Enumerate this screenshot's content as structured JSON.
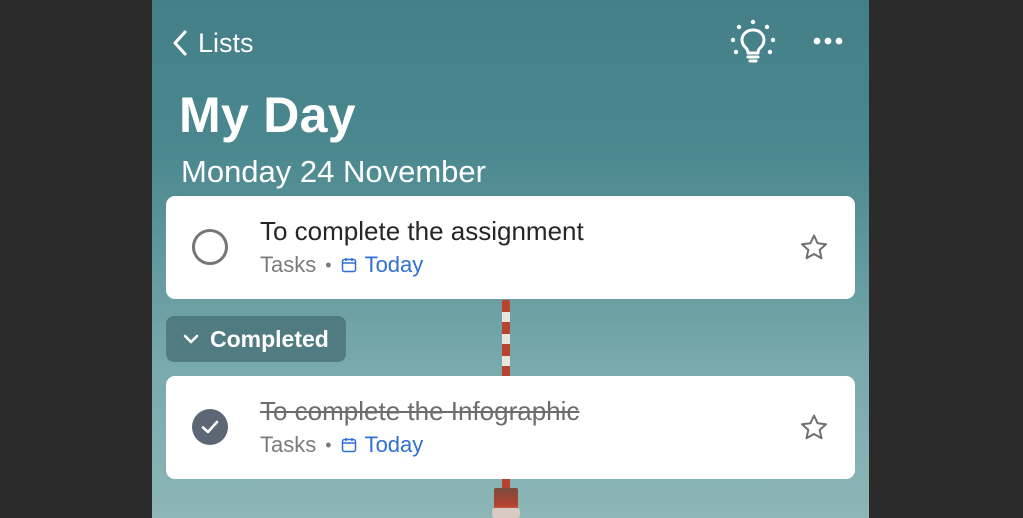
{
  "header": {
    "back_label": "Lists",
    "title": "My Day",
    "date": "Monday 24 November"
  },
  "icons": {
    "back": "chevron-left-icon",
    "suggestions": "lightbulb-icon",
    "more": "more-horizontal-icon",
    "calendar": "calendar-icon",
    "star": "star-outline-icon",
    "check": "checkmark-icon",
    "section_toggle": "chevron-down-icon"
  },
  "tasks": [
    {
      "title": "To complete the assignment",
      "list": "Tasks",
      "separator": "•",
      "due": "Today",
      "completed": false
    }
  ],
  "completed_section": {
    "label": "Completed",
    "expanded": true,
    "tasks": [
      {
        "title": "To complete the Infographic",
        "list": "Tasks",
        "separator": "•",
        "due": "Today",
        "completed": true
      }
    ]
  },
  "colors": {
    "accent_blue": "#2f6fd6",
    "completed_check": "#5c6674",
    "background_teal": "#4a878e"
  }
}
